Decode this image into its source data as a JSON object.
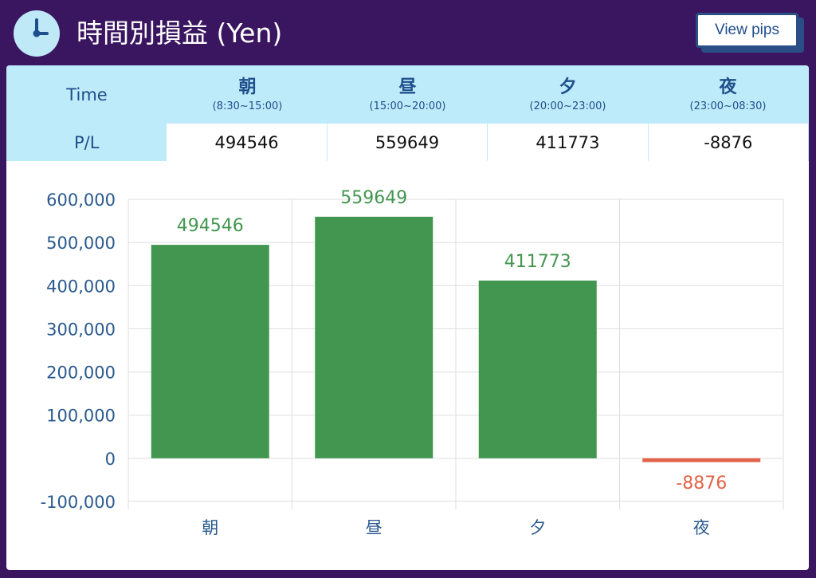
{
  "header": {
    "title": "時間別損益 (Yen)",
    "button_label": "View pips"
  },
  "table": {
    "row_labels": {
      "time": "Time",
      "pl": "P/L"
    },
    "periods": [
      {
        "name": "朝",
        "range": "(8:30~15:00)",
        "value": "494546"
      },
      {
        "name": "昼",
        "range": "(15:00~20:00)",
        "value": "559649"
      },
      {
        "name": "夕",
        "range": "(20:00~23:00)",
        "value": "411773"
      },
      {
        "name": "夜",
        "range": "(23:00~08:30)",
        "value": "-8876"
      }
    ]
  },
  "chart_data": {
    "type": "bar",
    "categories": [
      "朝",
      "昼",
      "夕",
      "夜"
    ],
    "values": [
      494546,
      559649,
      411773,
      -8876
    ],
    "data_labels": [
      "494546",
      "559649",
      "411773",
      "-8876"
    ],
    "yticks": [
      "600,000",
      "500,000",
      "400,000",
      "300,000",
      "200,000",
      "100,000",
      "0",
      "-100,000"
    ],
    "ytick_values": [
      600000,
      500000,
      400000,
      300000,
      200000,
      100000,
      0,
      -100000
    ],
    "ylim": [
      -100000,
      600000
    ],
    "grid": true,
    "colors": {
      "positive": "#43964f",
      "negative": "#e2634a",
      "axis_text": "#2a5a8f",
      "grid": "#dddddd"
    }
  }
}
